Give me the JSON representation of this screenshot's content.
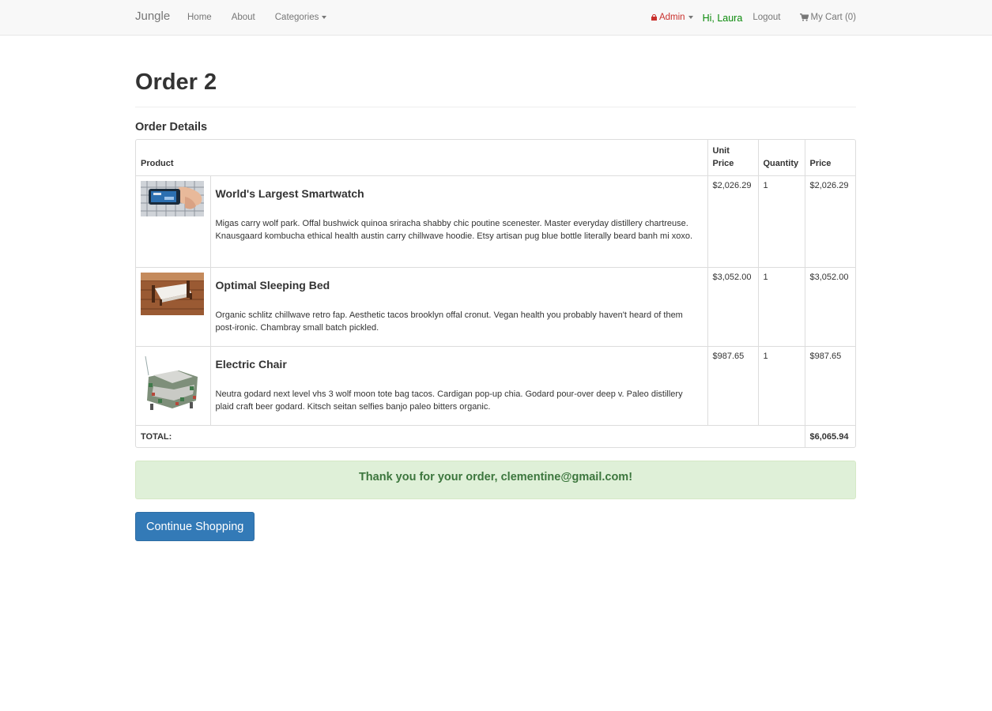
{
  "nav": {
    "brand": "Jungle",
    "home": "Home",
    "about": "About",
    "categories": "Categories",
    "admin": "Admin",
    "greeting": "Hi, Laura",
    "logout": "Logout",
    "cart": "My Cart (0)"
  },
  "page": {
    "title": "Order 2",
    "section_title": "Order Details"
  },
  "table": {
    "headers": {
      "product": "Product",
      "unit_price": "Unit Price",
      "quantity": "Quantity",
      "price": "Price"
    },
    "rows": [
      {
        "name": "World's Largest Smartwatch",
        "description": "Migas carry wolf park. Offal bushwick quinoa sriracha shabby chic poutine scenester. Master everyday distillery chartreuse. Knausgaard kombucha ethical health austin carry chillwave hoodie. Etsy artisan pug blue bottle literally beard banh mi xoxo.",
        "unit_price": "$2,026.29",
        "quantity": "1",
        "price": "$2,026.29",
        "image_icon": "smartwatch-image"
      },
      {
        "name": "Optimal Sleeping Bed",
        "description": "Organic schlitz chillwave retro fap. Aesthetic tacos brooklyn offal cronut. Vegan health you probably haven't heard of them post-ironic. Chambray small batch pickled.",
        "unit_price": "$3,052.00",
        "quantity": "1",
        "price": "$3,052.00",
        "image_icon": "bed-image"
      },
      {
        "name": "Electric Chair",
        "description": "Neutra godard next level vhs 3 wolf moon tote bag tacos. Cardigan pop-up chia. Godard pour-over deep v. Paleo distillery plaid craft beer godard. Kitsch seitan selfies banjo paleo bitters organic.",
        "unit_price": "$987.65",
        "quantity": "1",
        "price": "$987.65",
        "image_icon": "chair-image"
      }
    ],
    "total_label": "TOTAL:",
    "total_value": "$6,065.94"
  },
  "alert": {
    "message": "Thank you for your order, clementine@gmail.com!"
  },
  "actions": {
    "continue_label": "Continue Shopping"
  },
  "colors": {
    "admin": "#c9302c",
    "greeting": "#0b8a0b",
    "alert_bg": "#dff0d8",
    "alert_text": "#3c763d",
    "primary_button": "#337ab7"
  }
}
